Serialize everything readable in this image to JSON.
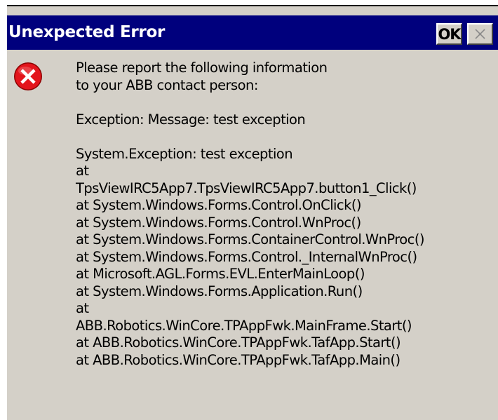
{
  "window": {
    "title": "Unexpected Error",
    "ok_label": "OK"
  },
  "icons": {
    "error": "error-icon",
    "close": "close-icon"
  },
  "colors": {
    "titlebar": "#00007d",
    "dialog_bg": "#d4d0c8",
    "error_red": "#e3151c"
  },
  "message": {
    "intro": [
      "Please report the following information",
      "to your ABB contact person:"
    ],
    "exception_message": "Exception: Message: test exception",
    "stack": [
      "System.Exception: test exception",
      "at",
      "TpsViewIRC5App7.TpsViewIRC5App7.button1_Click()",
      "at System.Windows.Forms.Control.OnClick()",
      "at System.Windows.Forms.Control.WnProc()",
      "at System.Windows.Forms.ContainerControl.WnProc()",
      "at System.Windows.Forms.Control._InternalWnProc()",
      "at Microsoft.AGL.Forms.EVL.EnterMainLoop()",
      "at System.Windows.Forms.Application.Run()",
      "at",
      "ABB.Robotics.WinCore.TPAppFwk.MainFrame.Start()",
      "at ABB.Robotics.WinCore.TPAppFwk.TafApp.Start()",
      "at ABB.Robotics.WinCore.TPAppFwk.TafApp.Main()"
    ]
  }
}
